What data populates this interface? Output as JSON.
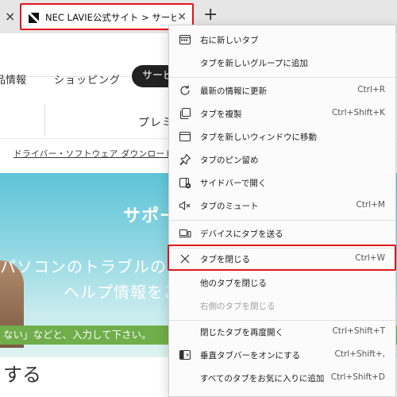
{
  "tabstrip": {
    "prev_tab_close": "×",
    "active_tab_title": "NEC LAVIE公式サイト > サービス＆サポート",
    "active_tab_close": "×",
    "new_tab": "+"
  },
  "page": {
    "nav": [
      "品情報",
      "ショッピング",
      "サービス"
    ],
    "sub_nav_item": "プレミアム",
    "driver_link": "ドライバー・ソフトウェア ダウンロード",
    "hero_title": "サポート",
    "hero_line1": "パソコンのトラブルの",
    "hero_line2": "ヘルプ情報をご",
    "search_hint": "ない」などと、入力して下さい。",
    "bottom_heading": "する"
  },
  "context_menu": {
    "items": [
      {
        "label": "右に新しいタブ",
        "shortcut": "",
        "icon": "tab-right-icon",
        "enabled": true
      },
      {
        "label": "タブを新しいグループに追加",
        "shortcut": "",
        "icon": "",
        "enabled": true
      },
      {
        "label": "最新の情報に更新",
        "shortcut": "Ctrl+R",
        "icon": "refresh-icon",
        "enabled": true
      },
      {
        "label": "タブを複製",
        "shortcut": "Ctrl+Shift+K",
        "icon": "duplicate-icon",
        "enabled": true
      },
      {
        "label": "タブを新しいウィンドウに移動",
        "shortcut": "",
        "icon": "window-icon",
        "enabled": true
      },
      {
        "label": "タブのピン留め",
        "shortcut": "",
        "icon": "pin-icon",
        "enabled": true
      },
      {
        "label": "サイドバーで開く",
        "shortcut": "",
        "icon": "sidebar-icon",
        "enabled": true
      },
      {
        "label": "タブのミュート",
        "shortcut": "Ctrl+M",
        "icon": "mute-icon",
        "enabled": true
      },
      {
        "label": "デバイスにタブを送る",
        "shortcut": "",
        "icon": "devices-icon",
        "enabled": true
      },
      {
        "label": "タブを閉じる",
        "shortcut": "Ctrl+W",
        "icon": "close-icon",
        "enabled": true
      },
      {
        "label": "他のタブを閉じる",
        "shortcut": "",
        "icon": "",
        "enabled": true
      },
      {
        "label": "右側のタブを閉じる",
        "shortcut": "",
        "icon": "",
        "enabled": false
      },
      {
        "label": "閉じたタブを再度開く",
        "shortcut": "Ctrl+Shift+T",
        "icon": "",
        "enabled": true
      },
      {
        "label": "垂直タブバーをオンにする",
        "shortcut": "Ctrl+Shift+,",
        "icon": "vertical-tabs-icon",
        "enabled": true
      },
      {
        "label": "すべてのタブをお気に入りに追加",
        "shortcut": "Ctrl+Shift+D",
        "icon": "",
        "enabled": true
      }
    ],
    "highlighted_item": "タブを閉じる",
    "highlight_color": "#e0151b"
  }
}
